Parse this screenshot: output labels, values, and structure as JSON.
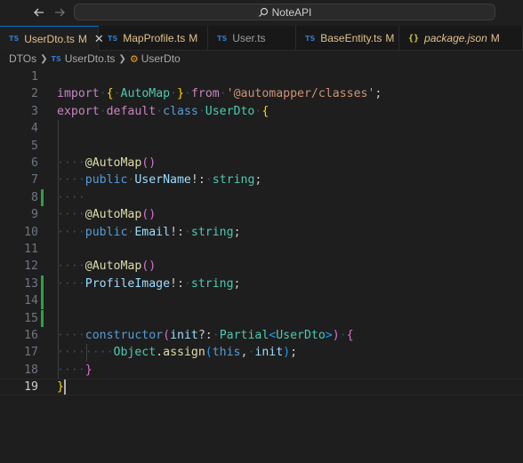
{
  "titlebar": {
    "search_text": "NoteAPI",
    "back_icon": "arrow-left-icon",
    "forward_icon": "arrow-right-icon"
  },
  "tabs": [
    {
      "label": "UserDto.ts",
      "status": "M",
      "icon": "typescript-icon",
      "active": true
    },
    {
      "label": "MapProfile.ts",
      "status": "M",
      "icon": "typescript-icon",
      "active": false
    },
    {
      "label": "User.ts",
      "status": "",
      "icon": "typescript-icon",
      "active": false
    },
    {
      "label": "BaseEntity.ts",
      "status": "M",
      "icon": "typescript-icon",
      "active": false
    },
    {
      "label": "package.json",
      "status": "M",
      "icon": "json-icon",
      "active": false
    }
  ],
  "breadcrumb": {
    "folder": "DTOs",
    "file": "UserDto.ts",
    "symbol": "UserDto"
  },
  "icon_labels": {
    "ts": "TS",
    "json": "{}"
  },
  "editor": {
    "current_line": 19,
    "lines": [
      {
        "n": "1",
        "text": ""
      },
      {
        "n": "2",
        "text": "import { AutoMap } from '@automapper/classes';"
      },
      {
        "n": "3",
        "text": "export default class UserDto {"
      },
      {
        "n": "4",
        "text": ""
      },
      {
        "n": "5",
        "text": ""
      },
      {
        "n": "6",
        "text": "    @AutoMap()"
      },
      {
        "n": "7",
        "text": "    public UserName!: string;"
      },
      {
        "n": "8",
        "text": "    "
      },
      {
        "n": "9",
        "text": "    @AutoMap()"
      },
      {
        "n": "10",
        "text": "    public Email!: string;"
      },
      {
        "n": "11",
        "text": ""
      },
      {
        "n": "12",
        "text": "    @AutoMap()"
      },
      {
        "n": "13",
        "text": "    ProfileImage!: string;"
      },
      {
        "n": "14",
        "text": ""
      },
      {
        "n": "15",
        "text": ""
      },
      {
        "n": "16",
        "text": "    constructor(init?: Partial<UserDto>) {"
      },
      {
        "n": "17",
        "text": "        Object.assign(this, init);"
      },
      {
        "n": "18",
        "text": "    }"
      },
      {
        "n": "19",
        "text": "}"
      }
    ],
    "modified_lines": [
      8,
      13,
      14,
      15
    ]
  },
  "colors": {
    "background": "#1e1e1e",
    "accent": "#0078d4",
    "modified": "#e2c08d",
    "gutter_added": "#2ea043"
  }
}
